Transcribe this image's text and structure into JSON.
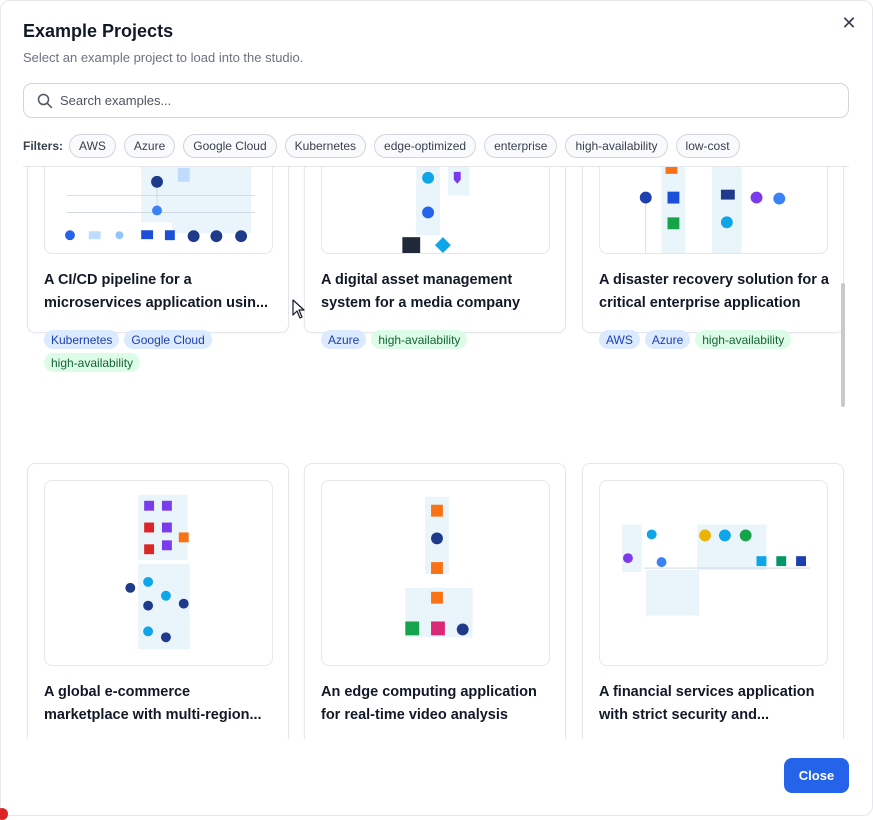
{
  "dialog": {
    "title": "Example Projects",
    "subtitle": "Select an example project to load into the studio.",
    "close_icon": "close-icon"
  },
  "search": {
    "placeholder": "Search examples...",
    "value": "",
    "icon": "search-icon"
  },
  "filters": {
    "label": "Filters:",
    "chips": [
      "AWS",
      "Azure",
      "Google Cloud",
      "Kubernetes",
      "edge-optimized",
      "enterprise",
      "high-availability",
      "low-cost"
    ]
  },
  "projects": [
    {
      "title": "A CI/CD pipeline for a microservices application usin...",
      "tags": [
        "Kubernetes",
        "Google Cloud",
        "high-availability"
      ]
    },
    {
      "title": "A digital asset management system for a media company",
      "tags": [
        "Azure",
        "high-availability"
      ]
    },
    {
      "title": "A disaster recovery solution for a critical enterprise application",
      "tags": [
        "AWS",
        "Azure",
        "high-availability"
      ]
    },
    {
      "title": "A global e-commerce marketplace with multi-region...",
      "tags": []
    },
    {
      "title": "An edge computing application for real-time video analysis",
      "tags": []
    },
    {
      "title": "A financial services application with strict security and...",
      "tags": []
    }
  ],
  "footer": {
    "close_label": "Close"
  },
  "colors": {
    "accent": "#2563eb",
    "tag_blue_bg": "#dbeafe",
    "tag_green_bg": "#dcfce7"
  }
}
